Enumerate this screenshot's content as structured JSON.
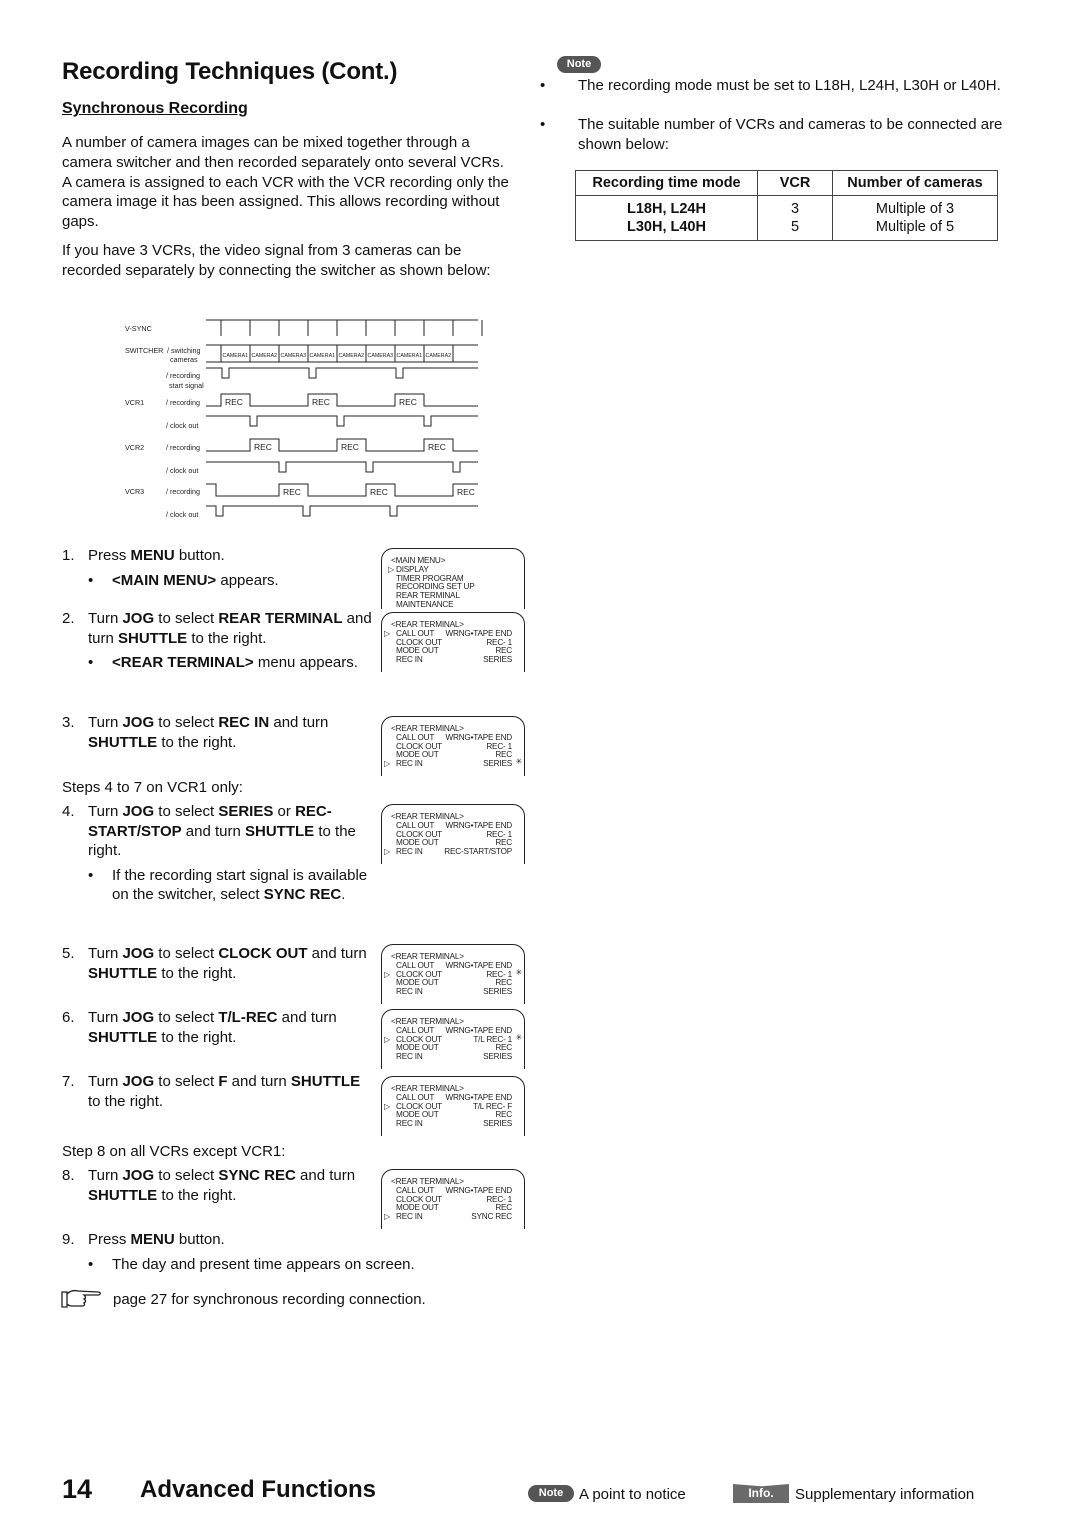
{
  "page": {
    "title": "Recording Techniques (Cont.)",
    "subtitle": "Synchronous Recording",
    "intro_paragraphs": [
      "A number of camera images can be mixed together through a camera switcher and then recorded separately onto several VCRs.  A camera is assigned to each VCR with the VCR recording only the camera image it has been assigned.  This allows recording without gaps.",
      "If you have 3 VCRs, the video signal from 3 cameras can be recorded separately by connecting the switcher as shown below:"
    ]
  },
  "timing_diagram": {
    "row_labels": {
      "vsync": "V-SYNC",
      "switcher": "SWITCHER",
      "switching": "/ switching",
      "cameras": "cameras",
      "recording": "/ recording",
      "start_signal": "start signal",
      "vcr1": "VCR1",
      "vcr2": "VCR2",
      "vcr3": "VCR3",
      "rec_rec": "/ recording",
      "clock_out": "/ clock out"
    },
    "camera_sequence": [
      "CAMERA1",
      "CAMERA2",
      "CAMERA3",
      "CAMERA1",
      "CAMERA2",
      "CAMERA3",
      "CAMERA1",
      "CAMERA2"
    ],
    "rec_label": "REC"
  },
  "steps": [
    {
      "num": "1.",
      "parts": [
        [
          "Press ",
          false
        ],
        [
          "MENU",
          true
        ],
        [
          " button.",
          false
        ]
      ],
      "bullets": [
        [
          [
            "<MAIN MENU>",
            true
          ],
          [
            " appears.",
            false
          ]
        ]
      ]
    },
    {
      "num": "2.",
      "parts": [
        [
          "Turn ",
          false
        ],
        [
          "JOG",
          true
        ],
        [
          " to select ",
          false
        ],
        [
          "REAR TERMINAL",
          true
        ],
        [
          " and turn ",
          false
        ],
        [
          "SHUTTLE",
          true
        ],
        [
          " to the right.",
          false
        ]
      ],
      "bullets": [
        [
          [
            "<REAR TERMINAL>",
            true
          ],
          [
            " menu appears.",
            false
          ]
        ]
      ]
    },
    {
      "num": "3.",
      "parts": [
        [
          "Turn ",
          false
        ],
        [
          "JOG",
          true
        ],
        [
          " to select ",
          false
        ],
        [
          "REC IN",
          true
        ],
        [
          " and turn ",
          false
        ],
        [
          "SHUTTLE",
          true
        ],
        [
          " to the right.",
          false
        ]
      ],
      "bullets": []
    },
    {
      "num": "4.",
      "parts": [
        [
          "Turn ",
          false
        ],
        [
          "JOG",
          true
        ],
        [
          " to select ",
          false
        ],
        [
          "SERIES",
          true
        ],
        [
          " or ",
          false
        ],
        [
          "REC-START/STOP",
          true
        ],
        [
          " and turn ",
          false
        ],
        [
          "SHUTTLE",
          true
        ],
        [
          " to the right.",
          false
        ]
      ],
      "bullets": [
        [
          [
            "If the recording start signal is available on the switcher, select ",
            false
          ],
          [
            "SYNC REC",
            true
          ],
          [
            ".",
            false
          ]
        ]
      ]
    },
    {
      "num": "5.",
      "parts": [
        [
          "Turn ",
          false
        ],
        [
          "JOG",
          true
        ],
        [
          " to select ",
          false
        ],
        [
          "CLOCK OUT",
          true
        ],
        [
          " and turn ",
          false
        ],
        [
          "SHUTTLE",
          true
        ],
        [
          " to the right.",
          false
        ]
      ],
      "bullets": []
    },
    {
      "num": "6.",
      "parts": [
        [
          "Turn ",
          false
        ],
        [
          "JOG",
          true
        ],
        [
          " to select ",
          false
        ],
        [
          "T/L-REC",
          true
        ],
        [
          " and turn ",
          false
        ],
        [
          "SHUTTLE",
          true
        ],
        [
          " to the right.",
          false
        ]
      ],
      "bullets": []
    },
    {
      "num": "7.",
      "parts": [
        [
          "Turn ",
          false
        ],
        [
          "JOG",
          true
        ],
        [
          " to select ",
          false
        ],
        [
          "F",
          true
        ],
        [
          " and turn ",
          false
        ],
        [
          "SHUTTLE",
          true
        ],
        [
          " to the right.",
          false
        ]
      ],
      "bullets": []
    },
    {
      "num": "8.",
      "parts": [
        [
          "Turn ",
          false
        ],
        [
          "JOG",
          true
        ],
        [
          " to select ",
          false
        ],
        [
          "SYNC REC",
          true
        ],
        [
          " and turn ",
          false
        ],
        [
          "SHUTTLE",
          true
        ],
        [
          " to the right.",
          false
        ]
      ],
      "bullets": []
    },
    {
      "num": "9.",
      "parts": [
        [
          "Press ",
          false
        ],
        [
          "MENU",
          true
        ],
        [
          " button.",
          false
        ]
      ],
      "bullets": [
        [
          [
            "The day and present time appears on screen.",
            false
          ]
        ]
      ]
    }
  ],
  "step_notes": {
    "steps_4_7": "Steps 4 to 7 on VCR1 only:",
    "step_8": "Step 8 on all VCRs except VCR1:"
  },
  "reference": "page 27 for synchronous recording connection.",
  "osd_screens": {
    "main_menu": {
      "header": "<MAIN MENU>",
      "items": [
        "DISPLAY",
        "TIMER PROGRAM",
        "RECORDING SET UP",
        "REAR TERMINAL",
        "MAINTENANCE"
      ],
      "cursor_index": 0
    },
    "rear_terminal_screens": [
      {
        "cursor": 0,
        "values": [
          "WRNG•TAPE END",
          "REC- 1",
          "REC",
          "SERIES"
        ],
        "blink": -1
      },
      {
        "cursor": 3,
        "values": [
          "WRNG•TAPE END",
          "REC- 1",
          "REC",
          "SERIES"
        ],
        "blink": 3
      },
      {
        "cursor": 3,
        "values": [
          "WRNG•TAPE END",
          "REC- 1",
          "REC",
          "REC-START/STOP"
        ],
        "blink": -1
      },
      {
        "cursor": 1,
        "values": [
          "WRNG•TAPE END",
          "REC- 1",
          "REC",
          "SERIES"
        ],
        "blink": 1
      },
      {
        "cursor": 1,
        "values": [
          "WRNG•TAPE END",
          "T/L REC- 1",
          "REC",
          "SERIES"
        ],
        "blink": 1
      },
      {
        "cursor": 1,
        "values": [
          "WRNG•TAPE END",
          "T/L REC- F",
          "REC",
          "SERIES"
        ],
        "blink": -1
      },
      {
        "cursor": 3,
        "values": [
          "WRNG•TAPE END",
          "REC- 1",
          "REC",
          "SYNC REC"
        ],
        "blink": -1
      }
    ],
    "rear_terminal_header": "<REAR TERMINAL>",
    "rear_terminal_labels": [
      "CALL OUT",
      "CLOCK OUT",
      "MODE OUT",
      "REC IN"
    ]
  },
  "note": {
    "badge": "Note",
    "bullets": [
      "The recording mode must be set to L18H, L24H, L30H or L40H.",
      "The suitable number of VCRs and cameras to be connected are shown below:"
    ]
  },
  "modes_table": {
    "headers": [
      "Recording time mode",
      "VCR",
      "Number of cameras"
    ],
    "rows": [
      [
        "L18H, L24H",
        "3",
        "Multiple of 3"
      ],
      [
        "L30H, L40H",
        "5",
        "Multiple of 5"
      ]
    ]
  },
  "footer": {
    "page_number": "14",
    "section": "Advanced Functions",
    "note_badge": "Note",
    "note_legend": "A point to notice",
    "info_badge": "Info.",
    "info_legend": "Supplementary information"
  }
}
